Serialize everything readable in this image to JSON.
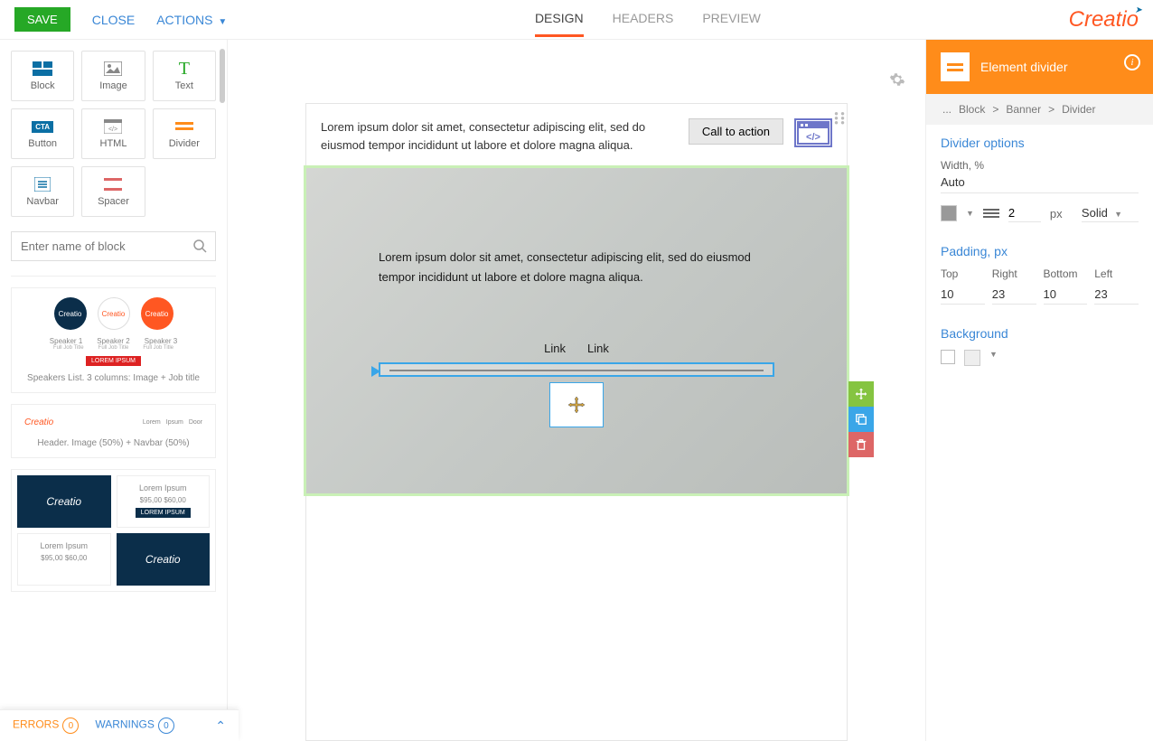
{
  "topbar": {
    "save": "SAVE",
    "close": "CLOSE",
    "actions": "ACTIONS"
  },
  "tabs": {
    "design": "DESIGN",
    "headers": "HEADERS",
    "preview": "PREVIEW"
  },
  "logo": "Creatio",
  "elements": {
    "block": "Block",
    "image": "Image",
    "text": "Text",
    "button": "Button",
    "html": "HTML",
    "divider": "Divider",
    "navbar": "Navbar",
    "spacer": "Spacer"
  },
  "search_placeholder": "Enter name of block",
  "blocks": {
    "speakers_caption": "Speakers List. 3 columns: Image + Job title",
    "speaker_labels": [
      "Speaker 1",
      "Speaker 2",
      "Speaker 3"
    ],
    "job": "Full Job Title",
    "lorem_btn": "LOREM IPSUM",
    "header_caption": "Header. Image (50%) + Navbar (50%)",
    "nav": [
      "Lorem",
      "Ipsum",
      "Door"
    ],
    "lorem": "Lorem Ipsum",
    "price": "$95,00 $60,00"
  },
  "canvas": {
    "p1": "Lorem ipsum dolor sit amet, consectetur adipiscing elit, sed do eiusmod tempor incididunt ut labore et dolore magna aliqua.",
    "cta": "Call to action",
    "p2": "Lorem ipsum dolor sit amet, consectetur adipiscing elit, sed do eiusmod tempor incididunt ut labore et dolore magna aliqua.",
    "link": "Link"
  },
  "rpanel": {
    "title": "Element divider",
    "crumb": {
      "block": "Block",
      "banner": "Banner",
      "divider": "Divider",
      "dots": "..."
    },
    "opts": "Divider options",
    "width_lbl": "Width, %",
    "width_val": "Auto",
    "thickness": "2",
    "unit": "px",
    "style": "Solid",
    "padding": "Padding, px",
    "pad": {
      "top_l": "Top",
      "right_l": "Right",
      "bottom_l": "Bottom",
      "left_l": "Left",
      "top": "10",
      "right": "23",
      "bottom": "10",
      "left": "23"
    },
    "bg": "Background"
  },
  "footer": {
    "errors": "ERRORS",
    "errors_n": "0",
    "warnings": "WARNINGS",
    "warnings_n": "0"
  }
}
